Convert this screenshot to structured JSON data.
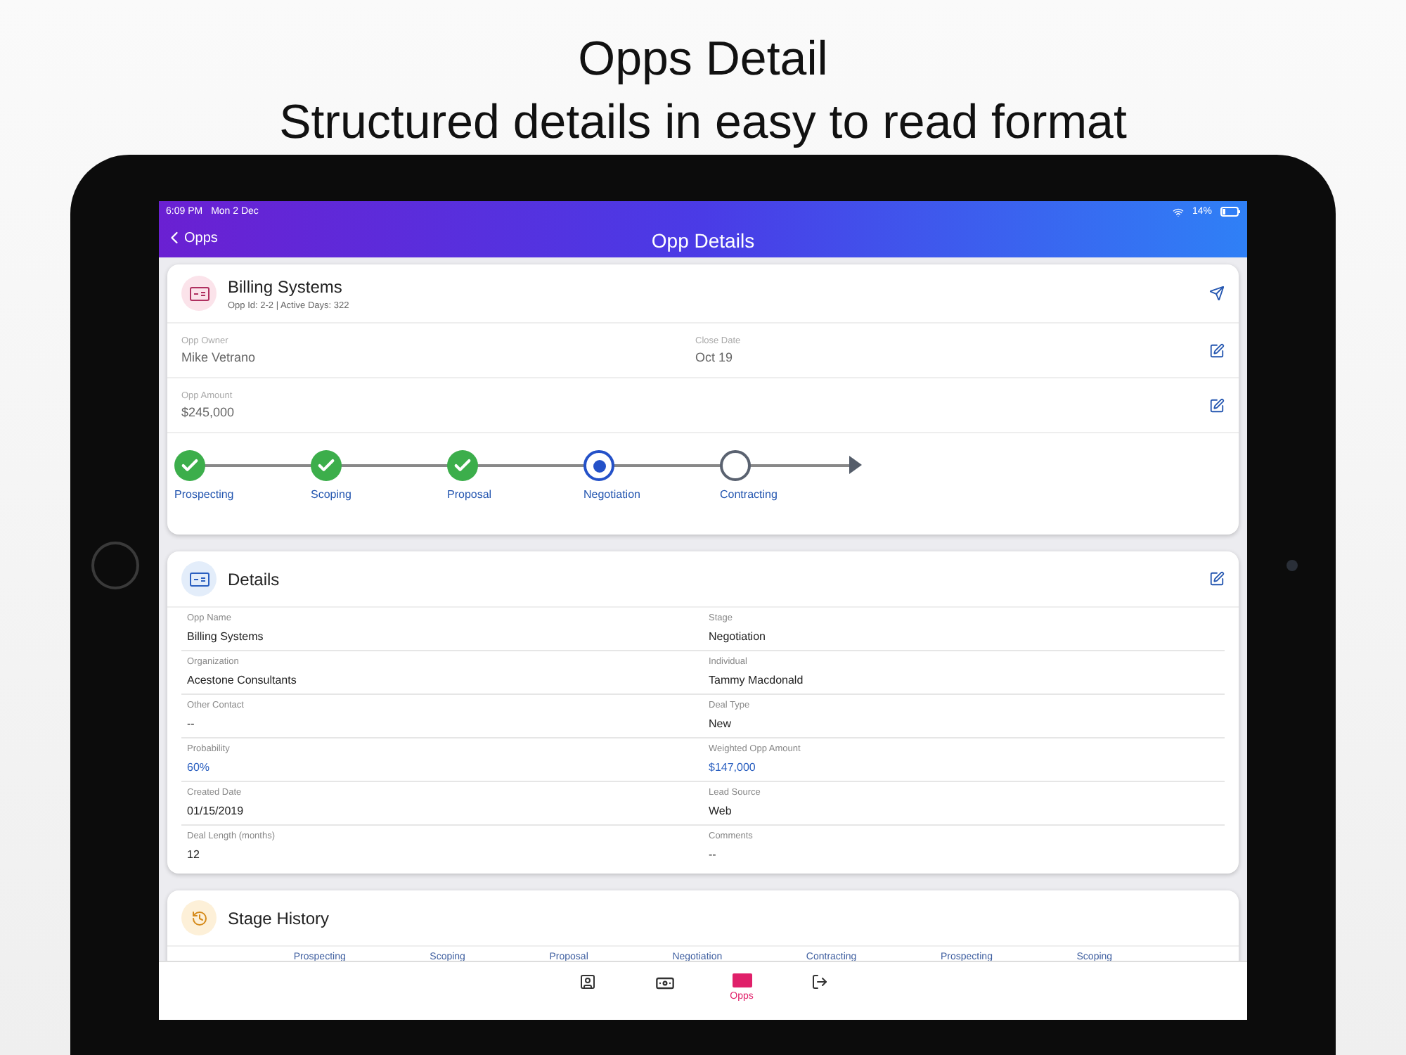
{
  "headline": {
    "title": "Opps Detail",
    "subtitle": "Structured details in easy to read format"
  },
  "status_bar": {
    "time": "6:09 PM",
    "date": "Mon 2 Dec",
    "battery": "14%"
  },
  "nav": {
    "back": "Opps",
    "title": "Opp Details"
  },
  "summary": {
    "title": "Billing Systems",
    "meta": "Opp Id: 2-2 | Active Days: 322",
    "rows": [
      {
        "fields": [
          {
            "label": "Opp Owner",
            "value": "Mike Vetrano"
          },
          {
            "label": "Close Date",
            "value": "Oct 19"
          }
        ]
      },
      {
        "fields": [
          {
            "label": "Opp Amount",
            "value": "$245,000"
          }
        ]
      }
    ],
    "stages": [
      {
        "label": "Prospecting",
        "done": true,
        "current": false
      },
      {
        "label": "Scoping",
        "done": true,
        "current": false
      },
      {
        "label": "Proposal",
        "done": true,
        "current": false
      },
      {
        "label": "Negotiation",
        "done": false,
        "current": true
      },
      {
        "label": "Contracting",
        "done": false,
        "current": false
      }
    ]
  },
  "details": {
    "title": "Details",
    "fields": [
      {
        "label": "Opp Name",
        "value": "Billing Systems",
        "kind": "plain"
      },
      {
        "label": "Stage",
        "value": "Negotiation",
        "kind": "plain"
      },
      {
        "label": "Organization",
        "value": "Acestone Consultants",
        "kind": "plain"
      },
      {
        "label": "Individual",
        "value": "Tammy Macdonald",
        "kind": "plain"
      },
      {
        "label": "Other Contact",
        "value": "--",
        "kind": "plain"
      },
      {
        "label": "Deal Type",
        "value": "New",
        "kind": "plain"
      },
      {
        "label": "Probability",
        "value": "60%",
        "kind": "highlight"
      },
      {
        "label": "Weighted Opp Amount",
        "value": "$147,000",
        "kind": "highlight"
      },
      {
        "label": "Created Date",
        "value": "01/15/2019",
        "kind": "plain"
      },
      {
        "label": "Lead Source",
        "value": "Web",
        "kind": "plain"
      },
      {
        "label": "Deal Length (months)",
        "value": "12",
        "kind": "plain"
      },
      {
        "label": "Comments",
        "value": "--",
        "kind": "plain"
      }
    ]
  },
  "stage_history": {
    "title": "Stage History",
    "columns": [
      "Prospecting",
      "Scoping",
      "Proposal",
      "Negotiation",
      "Contracting",
      "Prospecting",
      "Scoping"
    ]
  },
  "tab_bar": [
    {
      "kind": "contacts",
      "selected": false
    },
    {
      "kind": "money",
      "selected": false
    },
    {
      "kind": "opps",
      "label": "Opps",
      "selected": true
    },
    {
      "kind": "logout",
      "selected": false
    }
  ]
}
